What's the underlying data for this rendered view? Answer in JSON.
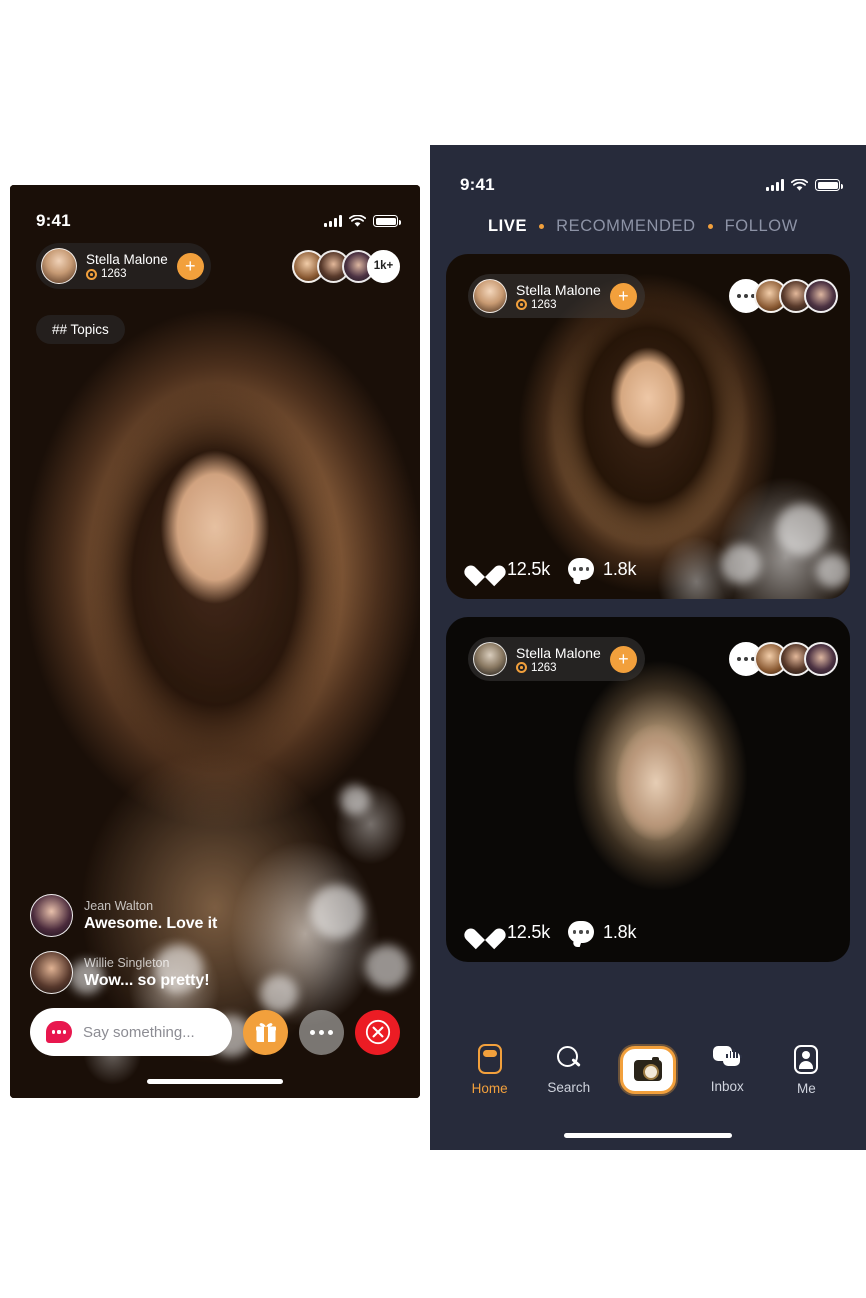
{
  "colors": {
    "accent_orange": "#F2A03C",
    "dark_navy": "#272B3B",
    "close_red": "#EC1C24",
    "bubble_pink": "#E8174E"
  },
  "left_phone": {
    "status_bar": {
      "time": "9:41",
      "signal_icon": "cellular-bars-icon",
      "wifi_icon": "wifi-icon",
      "battery_icon": "battery-full-icon"
    },
    "host": {
      "name": "Stella Malone",
      "views": "1263",
      "eye_icon": "eye-icon",
      "follow_label": "+"
    },
    "viewers": {
      "count_badge": "1k+"
    },
    "topics_pill": "## Topics",
    "chat": [
      {
        "user": "Jean Walton",
        "message": "Awesome. Love it"
      },
      {
        "user": "Willie Singleton",
        "message": "Wow... so pretty!"
      }
    ],
    "composer": {
      "placeholder": "Say something...",
      "chat_icon": "chat-bubble-icon",
      "gift_icon": "gift-icon",
      "more_icon": "more-dots-icon",
      "close_icon": "close-circle-icon"
    }
  },
  "right_phone": {
    "status_bar": {
      "time": "9:41",
      "signal_icon": "cellular-bars-icon",
      "wifi_icon": "wifi-icon",
      "battery_icon": "battery-full-icon"
    },
    "tabs": [
      {
        "label": "LIVE",
        "active": true
      },
      {
        "label": "RECOMMENDED",
        "active": false
      },
      {
        "label": "FOLLOW",
        "active": false
      }
    ],
    "cards": [
      {
        "host": {
          "name": "Stella Malone",
          "views": "1263",
          "eye_icon": "eye-icon",
          "follow_label": "+"
        },
        "more_icon": "more-dots-icon",
        "likes": "12.5k",
        "comments": "1.8k",
        "heart_icon": "heart-icon",
        "comment_icon": "comment-bubble-icon"
      },
      {
        "host": {
          "name": "Stella Malone",
          "views": "1263",
          "eye_icon": "eye-icon",
          "follow_label": "+"
        },
        "more_icon": "more-dots-icon",
        "likes": "12.5k",
        "comments": "1.8k",
        "heart_icon": "heart-icon",
        "comment_icon": "comment-bubble-icon"
      }
    ],
    "tabbar": [
      {
        "label": "Home",
        "icon": "home-icon",
        "active": true
      },
      {
        "label": "Search",
        "icon": "search-icon",
        "active": false
      },
      {
        "label": "",
        "icon": "camera-icon",
        "active": false
      },
      {
        "label": "Inbox",
        "icon": "inbox-icon",
        "active": false
      },
      {
        "label": "Me",
        "icon": "profile-icon",
        "active": false
      }
    ]
  }
}
